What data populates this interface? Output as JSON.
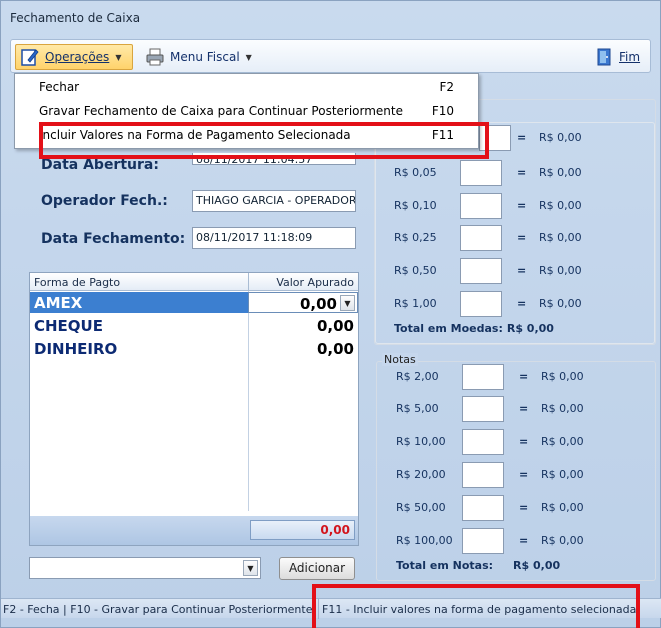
{
  "window": {
    "title": "Fechamento de Caixa"
  },
  "toolbar": {
    "operacoes_label": "Operações",
    "menu_fiscal_label": "Menu Fiscal",
    "fim_label": "Fim"
  },
  "menu": {
    "items": [
      {
        "label": "Fechar",
        "key": "F2"
      },
      {
        "label": "Gravar Fechamento de Caixa para Continuar Posteriormente",
        "key": "F10"
      },
      {
        "label": "Incluir Valores na Forma de Pagamento Selecionada",
        "key": "F11"
      }
    ]
  },
  "form": {
    "data_abertura_label": "Data Abertura:",
    "data_abertura_value": "08/11/2017 11:04:57",
    "operador_label": "Operador Fech.:",
    "operador_value": "THIAGO GARCIA - OPERADOR",
    "data_fechamento_label": "Data Fechamento:",
    "data_fechamento_value": "08/11/2017 11:18:09"
  },
  "grid": {
    "col_forma": "Forma de Pagto",
    "col_valor": "Valor Apurado",
    "rows": [
      {
        "name": "AMEX",
        "value": "0,00"
      },
      {
        "name": "CHEQUE",
        "value": "0,00"
      },
      {
        "name": "DINHEIRO",
        "value": "0,00"
      }
    ],
    "total": "0,00"
  },
  "adicionar_label": "Adicionar",
  "moedas": {
    "rows": [
      {
        "label": "",
        "eq": "=",
        "amount": "R$ 0,00"
      },
      {
        "label": "R$ 0,05",
        "eq": "=",
        "amount": "R$ 0,00"
      },
      {
        "label": "R$ 0,10",
        "eq": "=",
        "amount": "R$ 0,00"
      },
      {
        "label": "R$ 0,25",
        "eq": "=",
        "amount": "R$ 0,00"
      },
      {
        "label": "R$ 0,50",
        "eq": "=",
        "amount": "R$ 0,00"
      },
      {
        "label": "R$ 1,00",
        "eq": "=",
        "amount": "R$ 0,00"
      }
    ],
    "total_label": "Total em Moedas:",
    "total_value": "R$ 0,00"
  },
  "notas": {
    "title": "Notas",
    "rows": [
      {
        "label": "R$ 2,00",
        "eq": "=",
        "amount": "R$ 0,00"
      },
      {
        "label": "R$ 5,00",
        "eq": "=",
        "amount": "R$ 0,00"
      },
      {
        "label": "R$ 10,00",
        "eq": "=",
        "amount": "R$ 0,00"
      },
      {
        "label": "R$ 20,00",
        "eq": "=",
        "amount": "R$ 0,00"
      },
      {
        "label": "R$ 50,00",
        "eq": "=",
        "amount": "R$ 0,00"
      },
      {
        "label": "R$ 100,00",
        "eq": "=",
        "amount": "R$ 0,00"
      }
    ],
    "total_label": "Total em Notas:",
    "total_value": "R$ 0,00"
  },
  "statusbar": {
    "left": "F2 - Fecha | F10 - Gravar para Continuar Posteriormente",
    "right": "F11 - Incluir valores na forma de pagamento selecionada"
  },
  "colors": {
    "highlight": "#e31018",
    "selection": "#3c7fd0",
    "total_red": "#d2141c"
  }
}
